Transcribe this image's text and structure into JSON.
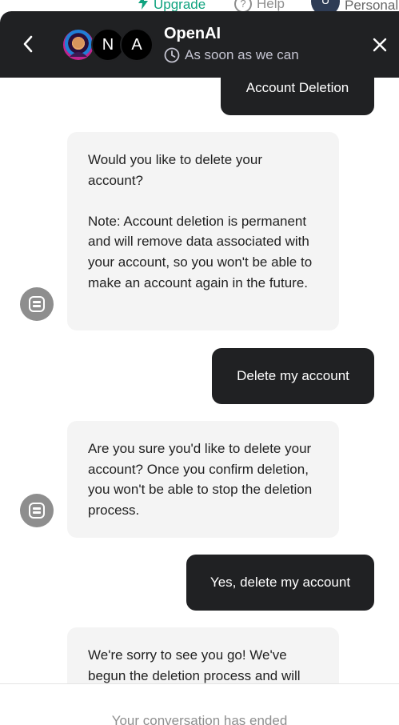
{
  "background_nav": {
    "upgrade_label": "Upgrade",
    "help_label": "Help",
    "help_icon": "?",
    "personal_label": "Personal",
    "user_initial": "U"
  },
  "header": {
    "title": "OpenAI",
    "subtitle": "As soon as we can",
    "avatars": [
      {
        "type": "photo",
        "label": ""
      },
      {
        "type": "initial",
        "label": "N"
      },
      {
        "type": "initial",
        "label": "A"
      }
    ]
  },
  "messages": [
    {
      "from": "user",
      "text": "Account Deletion"
    },
    {
      "from": "bot",
      "paragraphs": [
        "Would you like to delete your account?",
        "Note: Account deletion is permanent and will remove data associated with your account, so you won't be able to make an account again in the future."
      ]
    },
    {
      "from": "user",
      "text": "Delete my account"
    },
    {
      "from": "bot",
      "paragraphs": [
        "Are you sure you'd like to delete your account? Once you confirm deletion, you won't be able to stop the deletion process."
      ]
    },
    {
      "from": "user",
      "text": "Yes, delete my account"
    },
    {
      "from": "bot",
      "paragraphs": [
        "We're sorry to see you go! We've begun the deletion process and will"
      ]
    }
  ],
  "footer": {
    "status_text": "Your conversation has ended"
  },
  "colors": {
    "header_bg": "#202123",
    "user_bubble": "#202123",
    "bot_bubble": "#f4f4f4",
    "accent_green": "#10a37f"
  }
}
